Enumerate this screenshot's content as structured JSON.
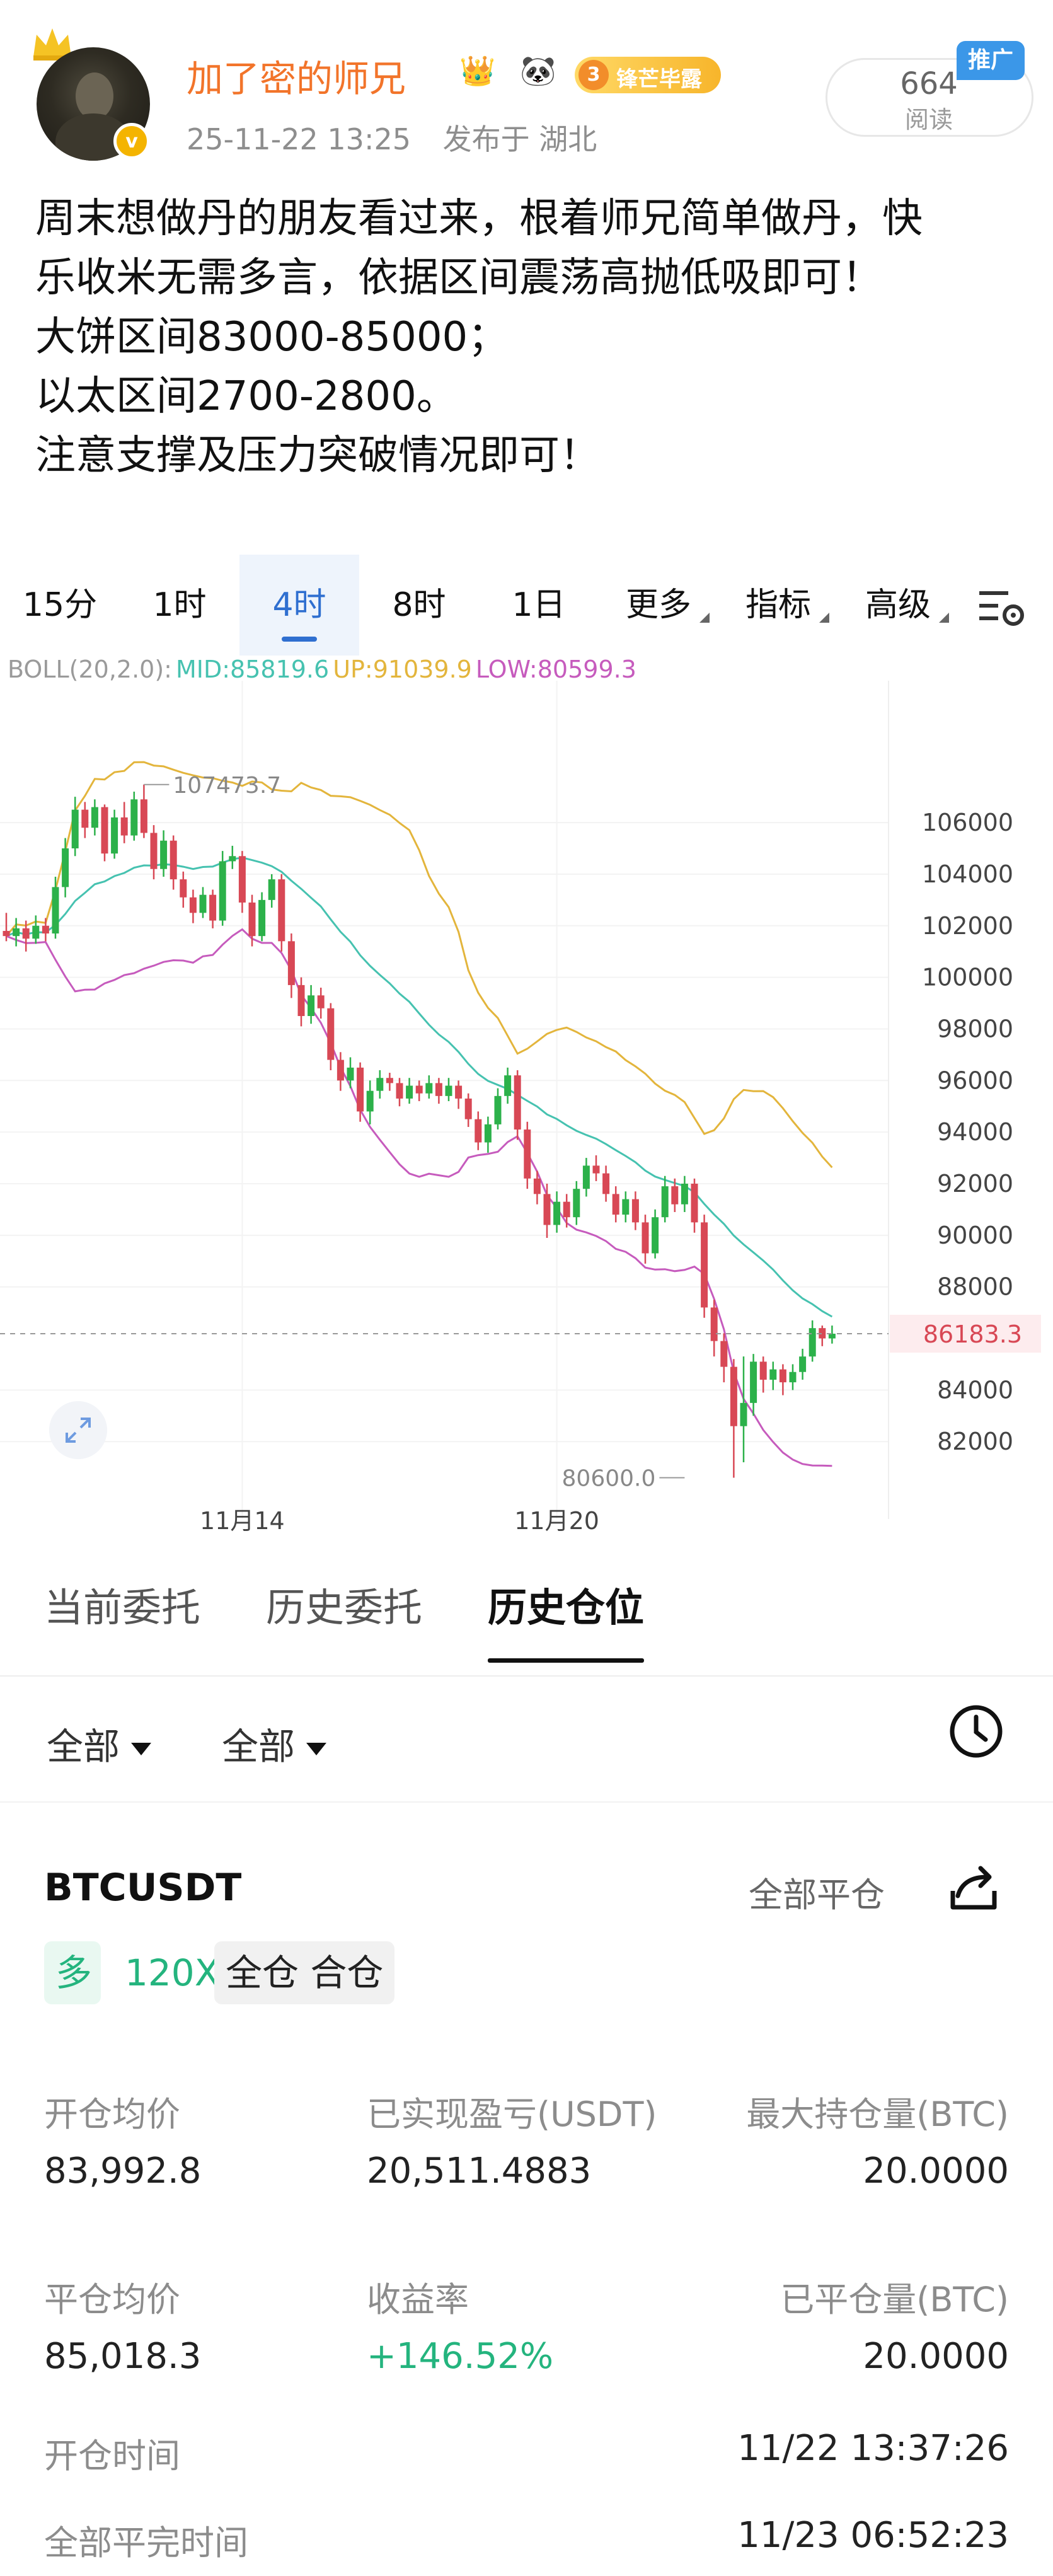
{
  "author": {
    "name": "加了密的师兄",
    "badge_icons": [
      "crown-badge-icon",
      "panda-icon"
    ],
    "rank_badge": {
      "number": "3",
      "text": "锋芒毕露"
    },
    "verified_mark": "v"
  },
  "post_meta": {
    "datetime": "25-11-22 13:25",
    "location": "发布于 湖北"
  },
  "read_stats": {
    "count": "664",
    "label": "阅读",
    "promo_tag": "推广"
  },
  "post_body": {
    "lines": [
      "周末想做丹的朋友看过来，根着师兄简单做丹，快",
      "乐收米无需多言，依据区间震荡高抛低吸即可！",
      "",
      "大饼区间83000-85000；",
      "以太区间2700-2800。",
      "注意支撑及压力突破情况即可！"
    ]
  },
  "chart_tabs": [
    {
      "label": "15分",
      "active": false
    },
    {
      "label": "1时",
      "active": false
    },
    {
      "label": "4时",
      "active": true
    },
    {
      "label": "8时",
      "active": false
    },
    {
      "label": "1日",
      "active": false
    },
    {
      "label": "更多",
      "active": false,
      "dropdown": true
    },
    {
      "label": "指标",
      "active": false,
      "dropdown": true
    },
    {
      "label": "高级",
      "active": false,
      "dropdown": true
    }
  ],
  "boll_legend": {
    "params": "BOLL(20,2.0):",
    "mid": "MID:85819.6",
    "up": "UP:91039.9",
    "low": "LOW:80599.3"
  },
  "colors": {
    "mid_line": "#46c2b0",
    "up_line": "#e3b53c",
    "low_line": "#c65bbd",
    "candle_up": "#2cb14a",
    "candle_down": "#d84855",
    "accent": "#2f6fd0",
    "brand_orange": "#f2742a"
  },
  "chart_data": {
    "type": "candlestick",
    "symbol": "BTCUSDT",
    "interval": "4时",
    "y_ticks": [
      106000,
      104000,
      102000,
      100000,
      98000,
      96000,
      94000,
      92000,
      90000,
      88000,
      84000,
      82000
    ],
    "y_tick_labels": [
      "106000",
      "104000",
      "102000",
      "100000",
      "98000",
      "96000",
      "94000",
      "92000",
      "90000",
      "88000",
      "84000",
      "82000"
    ],
    "ylim": [
      79000,
      111500
    ],
    "x_tick_labels": [
      "11月14",
      "11月20"
    ],
    "x_tick_index": [
      24,
      56
    ],
    "current_price": 86183.3,
    "current_price_label": "86183.3",
    "high_marker": {
      "value": 107473.7,
      "label": "107473.7",
      "index": 14
    },
    "low_marker": {
      "value": 80600.0,
      "label": "80600.0",
      "index": 69
    },
    "candles": [
      [
        101800,
        101600,
        102500,
        101400
      ],
      [
        101600,
        101900,
        102300,
        101200
      ],
      [
        101900,
        101500,
        102200,
        101000
      ],
      [
        101500,
        102000,
        102400,
        101300
      ],
      [
        102000,
        101700,
        102300,
        101400
      ],
      [
        101700,
        103500,
        103900,
        101500
      ],
      [
        103500,
        105000,
        105400,
        103100
      ],
      [
        105000,
        106500,
        107000,
        104700
      ],
      [
        106500,
        105800,
        106800,
        105400
      ],
      [
        105800,
        106600,
        106900,
        105500
      ],
      [
        106600,
        104800,
        106700,
        104500
      ],
      [
        104800,
        106200,
        106500,
        104600
      ],
      [
        106200,
        105500,
        106800,
        105200
      ],
      [
        105500,
        106900,
        107200,
        105300
      ],
      [
        106900,
        105600,
        107473.7,
        105400
      ],
      [
        105600,
        104200,
        105900,
        103800
      ],
      [
        104200,
        105300,
        105700,
        103900
      ],
      [
        105300,
        103800,
        105500,
        103400
      ],
      [
        103800,
        103100,
        104100,
        102700
      ],
      [
        103100,
        102500,
        103400,
        102100
      ],
      [
        102500,
        103200,
        103500,
        102300
      ],
      [
        103200,
        102200,
        103400,
        101900
      ],
      [
        102200,
        104500,
        104900,
        102000
      ],
      [
        104500,
        104700,
        105100,
        104200
      ],
      [
        104700,
        102900,
        104900,
        102500
      ],
      [
        102900,
        101600,
        103200,
        101200
      ],
      [
        101600,
        103000,
        103300,
        101400
      ],
      [
        103000,
        103800,
        104000,
        102700
      ],
      [
        103800,
        101400,
        104000,
        101000
      ],
      [
        101400,
        99700,
        101700,
        99200
      ],
      [
        99700,
        98500,
        100000,
        98100
      ],
      [
        98500,
        99300,
        99700,
        98200
      ],
      [
        99300,
        98800,
        99600,
        98400
      ],
      [
        98800,
        96800,
        99000,
        96400
      ],
      [
        96800,
        96000,
        97100,
        95600
      ],
      [
        96000,
        96500,
        96900,
        95700
      ],
      [
        96500,
        94800,
        96700,
        94400
      ],
      [
        94800,
        95600,
        96000,
        94300
      ],
      [
        95600,
        96100,
        96400,
        95300
      ],
      [
        96100,
        95900,
        96300,
        95600
      ],
      [
        95900,
        95300,
        96100,
        95000
      ],
      [
        95300,
        95800,
        96100,
        95100
      ],
      [
        95800,
        95500,
        96000,
        95200
      ],
      [
        95500,
        95900,
        96200,
        95300
      ],
      [
        95900,
        95400,
        96100,
        95100
      ],
      [
        95400,
        95800,
        96100,
        95200
      ],
      [
        95800,
        95300,
        96000,
        94900
      ],
      [
        95300,
        94500,
        95500,
        94200
      ],
      [
        94500,
        93600,
        94800,
        93300
      ],
      [
        93600,
        94300,
        94600,
        93200
      ],
      [
        94300,
        95400,
        95700,
        94100
      ],
      [
        95400,
        96200,
        96500,
        95100
      ],
      [
        96200,
        94100,
        96400,
        93700
      ],
      [
        94100,
        92200,
        94400,
        91800
      ],
      [
        92200,
        91600,
        92500,
        91200
      ],
      [
        91600,
        90400,
        92000,
        89900
      ],
      [
        90400,
        91300,
        91700,
        90100
      ],
      [
        91300,
        90700,
        91600,
        90300
      ],
      [
        90700,
        91800,
        92100,
        90400
      ],
      [
        91800,
        92700,
        93000,
        91500
      ],
      [
        92700,
        92400,
        93100,
        92100
      ],
      [
        92400,
        91600,
        92700,
        91300
      ],
      [
        91600,
        90800,
        91900,
        90500
      ],
      [
        90800,
        91400,
        91700,
        90500
      ],
      [
        91400,
        90500,
        91700,
        90200
      ],
      [
        90500,
        89300,
        90800,
        88900
      ],
      [
        89300,
        90700,
        91000,
        89100
      ],
      [
        90700,
        91900,
        92300,
        90500
      ],
      [
        91900,
        91200,
        92200,
        90900
      ],
      [
        91200,
        92000,
        92300,
        90900
      ],
      [
        92000,
        90500,
        92200,
        90100
      ],
      [
        90500,
        87200,
        90800,
        86800
      ],
      [
        87200,
        85900,
        87500,
        85300
      ],
      [
        85900,
        84900,
        86200,
        84300
      ],
      [
        84900,
        82600,
        85200,
        80600
      ],
      [
        82600,
        83500,
        85300,
        81200
      ],
      [
        83500,
        85100,
        85400,
        83000
      ],
      [
        85100,
        84400,
        85300,
        83900
      ],
      [
        84400,
        84800,
        85100,
        84000
      ],
      [
        84800,
        84300,
        85000,
        83800
      ],
      [
        84300,
        84700,
        85000,
        84000
      ],
      [
        84700,
        85300,
        85600,
        84400
      ],
      [
        85300,
        86400,
        86700,
        85100
      ],
      [
        86400,
        86000,
        86500,
        85700
      ],
      [
        86000,
        86183.3,
        86500,
        85800
      ]
    ],
    "boll_mid_visible_end": 85819.6,
    "boll_up_visible_end": 91039.9,
    "boll_low_visible_end": 80599.3
  },
  "order_tabs": [
    {
      "label": "当前委托",
      "active": false
    },
    {
      "label": "历史委托",
      "active": false
    },
    {
      "label": "历史仓位",
      "active": true
    }
  ],
  "filters": [
    {
      "label": "全部"
    },
    {
      "label": "全部"
    }
  ],
  "position": {
    "symbol": "BTCUSDT",
    "close_all": "全部平仓",
    "side": "多",
    "leverage": "120X",
    "mode": "全仓 合仓",
    "fields": [
      {
        "label": "开仓均价",
        "value": "83,992.8"
      },
      {
        "label": "已实现盈亏(USDT)",
        "value": "20,511.4883"
      },
      {
        "label": "最大持仓量(BTC)",
        "value": "20.0000"
      },
      {
        "label": "平仓均价",
        "value": "85,018.3"
      },
      {
        "label": "收益率",
        "value": "+146.52%"
      },
      {
        "label": "已平仓量(BTC)",
        "value": "20.0000"
      },
      {
        "label": "开仓时间",
        "value": "11/22 13:37:26"
      },
      {
        "label": "全部平完时间",
        "value": "11/23 06:52:23"
      }
    ]
  }
}
